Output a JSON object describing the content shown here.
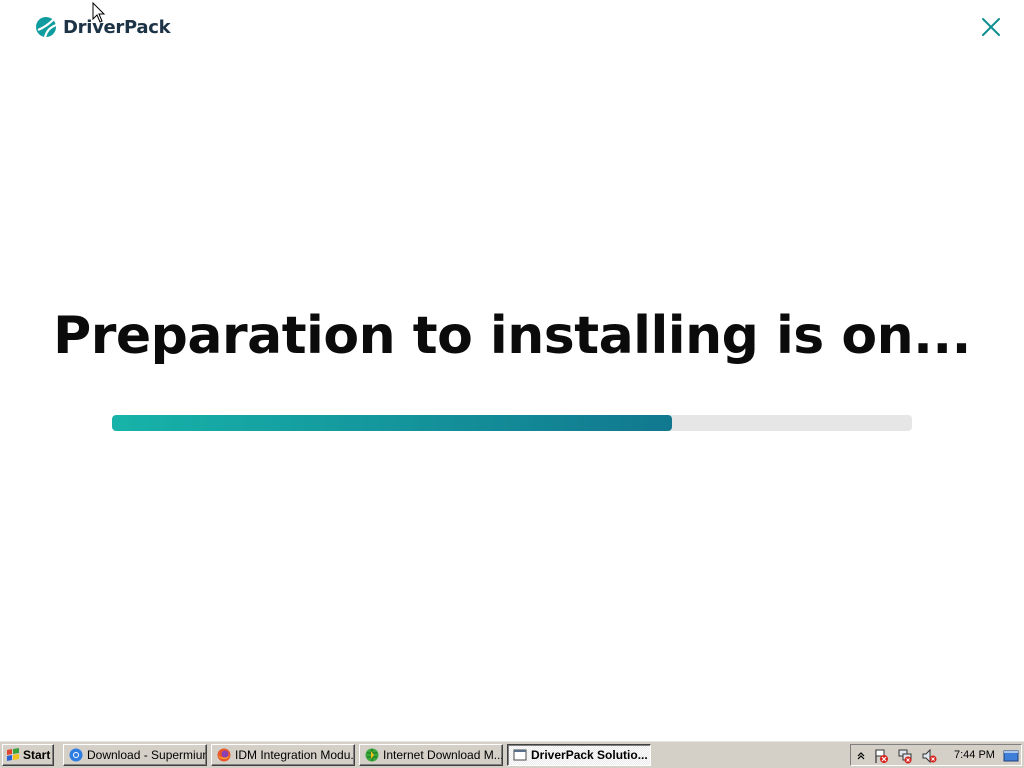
{
  "app": {
    "name": "DriverPack",
    "headline": "Preparation to installing is on...",
    "progress_fraction": 0.7,
    "accent_start": "#17b3a9",
    "accent_end": "#11788f",
    "close_icon": "close-icon"
  },
  "taskbar": {
    "start_label": "Start",
    "tasks": [
      {
        "label": "Download - Supermium",
        "icon": "chromium-browser-icon",
        "active": false
      },
      {
        "label": "IDM Integration Modu...",
        "icon": "firefox-icon",
        "active": false
      },
      {
        "label": "Internet Download M...",
        "icon": "idm-globe-icon",
        "active": false
      },
      {
        "label": "DriverPack Solutio...",
        "icon": "window-app-icon",
        "active": true
      }
    ],
    "tray_icons": [
      "show-hidden-icon",
      "flag-alert-icon",
      "network-alert-icon",
      "volume-muted-icon"
    ],
    "clock": "7:44 PM",
    "show_desktop_icon": "show-desktop-icon"
  }
}
